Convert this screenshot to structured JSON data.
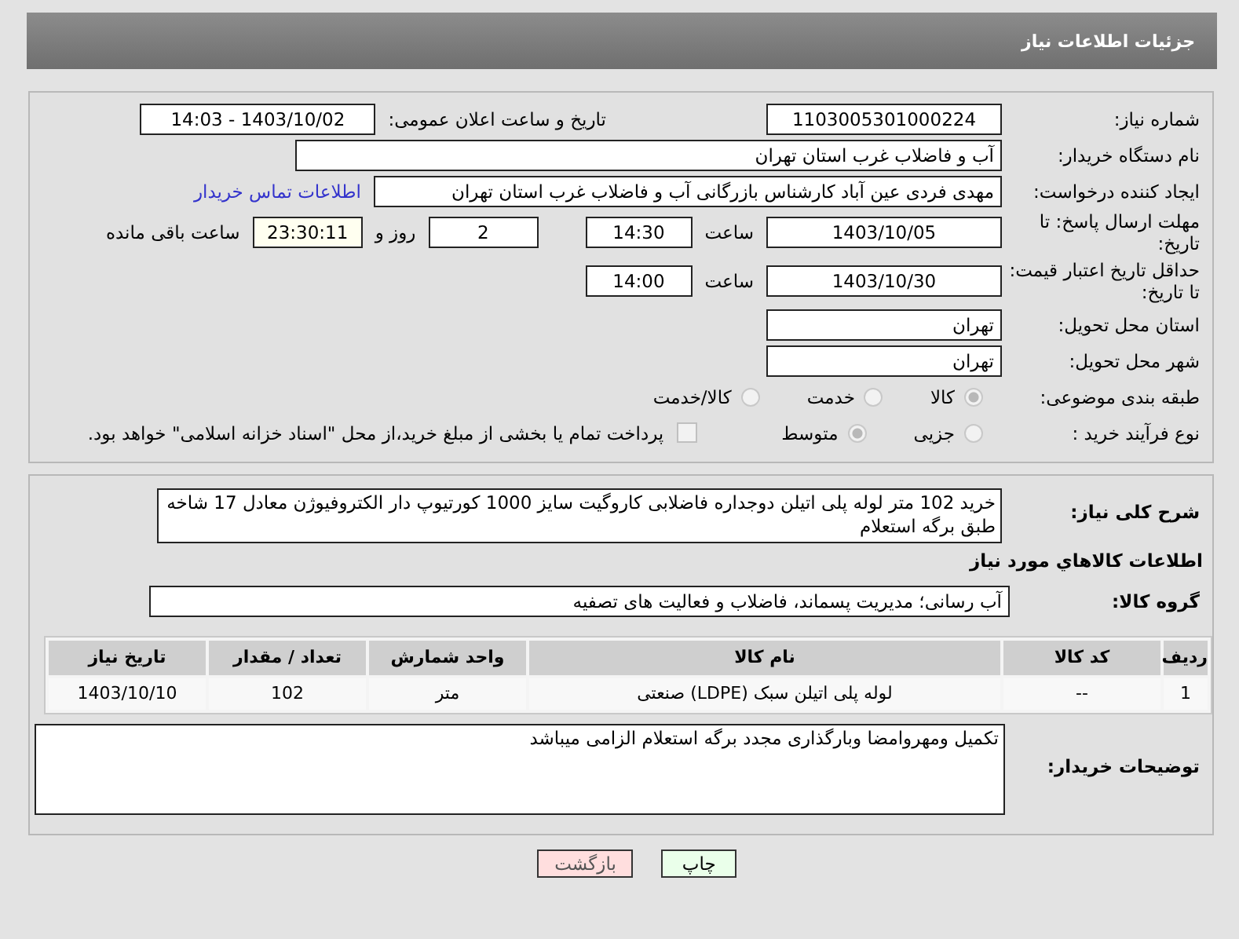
{
  "title": "جزئیات اطلاعات نیاز",
  "need_number": {
    "label": "شماره نیاز:",
    "value": "1103005301000224"
  },
  "announce": {
    "label": "تاریخ و ساعت اعلان عمومی:",
    "value": "1403/10/02 - 14:03"
  },
  "buyer": {
    "label": "نام دستگاه خریدار:",
    "value": "آب و فاضلاب غرب استان تهران"
  },
  "requester": {
    "label": "ایجاد کننده درخواست:",
    "value": "مهدی فردی عین آباد کارشناس بازرگانی آب و فاضلاب غرب استان تهران",
    "link": "اطلاعات تماس خریدار"
  },
  "deadline": {
    "label": "مهلت ارسال پاسخ: تا تاریخ:",
    "date": "1403/10/05",
    "time_label": "ساعت",
    "time": "14:30",
    "days": "2",
    "days_label": "روز و",
    "remaining": "23:30:11",
    "remaining_label": "ساعت باقی مانده"
  },
  "validity": {
    "label": "حداقل تاریخ اعتبار قیمت: تا تاریخ:",
    "date": "1403/10/30",
    "time_label": "ساعت",
    "time": "14:00"
  },
  "province": {
    "label": "استان محل تحویل:",
    "value": "تهران"
  },
  "city": {
    "label": "شهر محل تحویل:",
    "value": "تهران"
  },
  "category": {
    "label": "طبقه بندی موضوعی:",
    "options": [
      {
        "label": "کالا",
        "selected": true
      },
      {
        "label": "خدمت",
        "selected": false
      },
      {
        "label": "کالا/خدمت",
        "selected": false
      }
    ]
  },
  "process": {
    "label": "نوع فرآیند خرید :",
    "options": [
      {
        "label": "جزیی",
        "selected": false
      },
      {
        "label": "متوسط",
        "selected": true
      }
    ],
    "treasury": {
      "checked": false,
      "text": "پرداخت تمام یا بخشی از مبلغ خرید،از محل \"اسناد خزانه اسلامی\" خواهد بود."
    }
  },
  "description": {
    "label": "شرح کلی نیاز:",
    "value": "خرید 102 متر لوله پلی اتیلن دوجداره فاضلابی کاروگیت سایز 1000 کورتیوپ دار الکتروفیوژن معادل 17 شاخه طبق برگه استعلام"
  },
  "goods_heading": "اطلاعات کالاهاي مورد نياز",
  "goods_group": {
    "label": "گروه کالا:",
    "value": "آب رسانی؛ مدیریت پسماند، فاضلاب و فعالیت های تصفیه"
  },
  "table": {
    "columns": [
      "ردیف",
      "کد کالا",
      "نام کالا",
      "واحد شمارش",
      "تعداد / مقدار",
      "تاریخ نیاز"
    ],
    "rows": [
      [
        "1",
        "--",
        "لوله پلی اتیلن سبک (LDPE) صنعتی",
        "متر",
        "102",
        "1403/10/10"
      ]
    ]
  },
  "buyer_notes": {
    "label": "توضیحات خریدار:",
    "value": "تکمیل ومهروامضا وبارگذاری مجدد برگه استعلام الزامی میباشد"
  },
  "buttons": [
    {
      "kind": "print",
      "label": "چاپ"
    },
    {
      "kind": "back",
      "label": "بازگشت"
    }
  ]
}
